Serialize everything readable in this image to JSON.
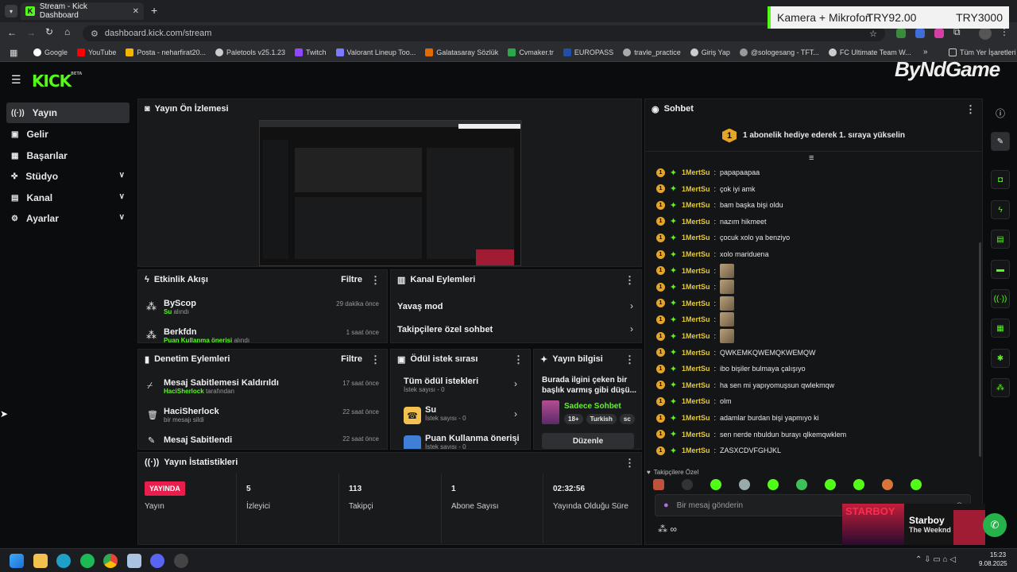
{
  "browser": {
    "tab_title": "Stream - Kick Dashboard",
    "url": "dashboard.kick.com/stream",
    "bookmarks": [
      "Google",
      "YouTube",
      "Posta - neharfirat20...",
      "Paletools v25.1.23",
      "Twitch",
      "Valorant Lineup Too...",
      "Galatasaray Sözlük",
      "Cvmaker.tr",
      "EUROPASS",
      "travle_practice",
      "Giriş Yap",
      "@sologesang - TFT...",
      "FC Ultimate Team W..."
    ],
    "bookmarks_more": "»",
    "all_bookmarks": "Tüm Yer İşaretleri"
  },
  "overlay": {
    "camera_text": "Kamera + Mikrofon",
    "price1": "TRY92.00",
    "price2": "TRY3000",
    "brand": "ByNdGame",
    "song_title": "Starboy",
    "song_artist": "The Weeknd",
    "album_text": "STARBOY"
  },
  "app": {
    "logo": "KICK",
    "logo_beta": "BETA"
  },
  "sidebar": {
    "items": [
      {
        "label": "Yayın",
        "icon": "broadcast-icon"
      },
      {
        "label": "Gelir",
        "icon": "income-icon"
      },
      {
        "label": "Başarılar",
        "icon": "achievements-icon"
      },
      {
        "label": "Stüdyo",
        "icon": "studio-icon"
      },
      {
        "label": "Kanal",
        "icon": "channel-icon"
      },
      {
        "label": "Ayarlar",
        "icon": "settings-icon"
      }
    ]
  },
  "preview": {
    "title": "Yayın Ön İzlemesi"
  },
  "activity": {
    "title": "Etkinlik Akışı",
    "filter": "Filtre",
    "items": [
      {
        "name": "ByScop",
        "action_highlight": "Su",
        "action": "alındı",
        "time": "29 dakika önce"
      },
      {
        "name": "Berkfdn",
        "action_highlight": "Puan Kullanma önerisi",
        "action": "alındı",
        "time": "1 saat önce"
      }
    ]
  },
  "channel_actions": {
    "title": "Kanal Eylemleri",
    "items": [
      "Yavaş mod",
      "Takipçilere özel sohbet"
    ]
  },
  "moderation": {
    "title": "Denetim Eylemleri",
    "filter": "Filtre",
    "items": [
      {
        "title": "Mesaj Sabitlemesi Kaldırıldı",
        "user": "HaciSherlock",
        "sub": "tarafından",
        "time": "17 saat önce"
      },
      {
        "title": "HaciSherlock",
        "user": "",
        "sub": "bir mesajı sildi",
        "time": "22 saat önce"
      },
      {
        "title": "Mesaj Sabitlendi",
        "user": "",
        "sub": "",
        "time": "22 saat önce"
      }
    ]
  },
  "rewards": {
    "title": "Ödül istek sırası",
    "items": [
      {
        "title": "Tüm ödül istekleri",
        "sub": "İstek sayısı - 0"
      },
      {
        "title": "Su",
        "sub": "İstek sayısı - 0"
      },
      {
        "title": "Puan Kullanma önerisi",
        "sub": "İstek sayısı - 0"
      }
    ]
  },
  "stream_info": {
    "title": "Yayın bilgisi",
    "stream_title": "Burada ilgini çeken bir başlık varmış gibi düşü...",
    "category": "Sadece Sohbet",
    "tags": [
      "18+",
      "Turkish",
      "sc"
    ],
    "edit": "Düzenle"
  },
  "stats": {
    "title": "Yayın İstatistikleri",
    "live_badge": "YAYINDA",
    "cols": [
      {
        "value": "",
        "label": "Yayın"
      },
      {
        "value": "5",
        "label": "İzleyici"
      },
      {
        "value": "113",
        "label": "Takipçi"
      },
      {
        "value": "1",
        "label": "Abone Sayısı"
      },
      {
        "value": "02:32:56",
        "label": "Yayında Olduğu Süre"
      }
    ]
  },
  "chat": {
    "title": "Sohbet",
    "gift_banner": "1 abonelik hediye ederek 1. sıraya yükselin",
    "gift_rank": "1",
    "messages": [
      {
        "user": "1MertSu",
        "text": "papapaapaa"
      },
      {
        "user": "1MertSu",
        "text": "çok iyi amk"
      },
      {
        "user": "1MertSu",
        "text": "bam başka bişi oldu"
      },
      {
        "user": "1MertSu",
        "text": "nazım hikmeet"
      },
      {
        "user": "1MertSu",
        "text": "çocuk xolo ya benziyo"
      },
      {
        "user": "1MertSu",
        "text": "xolo mariduena"
      },
      {
        "user": "1MertSu",
        "text": ""
      },
      {
        "user": "1MertSu",
        "text": ""
      },
      {
        "user": "1MertSu",
        "text": ""
      },
      {
        "user": "1MertSu",
        "text": ""
      },
      {
        "user": "1MertSu",
        "text": ""
      },
      {
        "user": "1MertSu",
        "text": "QWKEMKQWEMQKWEMQW"
      },
      {
        "user": "1MertSu",
        "text": "ibo bişiler bulmaya çalışıyo"
      },
      {
        "user": "1MertSu",
        "text": "ha sen mi yapıyomuşsun qwlekmqw"
      },
      {
        "user": "1MertSu",
        "text": "olm"
      },
      {
        "user": "1MertSu",
        "text": "adamlar burdan bişi yapmıyo ki"
      },
      {
        "user": "1MertSu",
        "text": "sen nerde nbuldun burayı qlkemqwklem"
      },
      {
        "user": "1MertSu",
        "text": "ZASXCDVFGHJKL"
      }
    ],
    "followers_only": "Takipçilere Özel",
    "input_placeholder": "Bir mesaj gönderin"
  },
  "taskbar": {
    "time": "15:23",
    "date": "9.08.2025"
  },
  "colors": {
    "accent": "#53fc18",
    "live": "#e91e4c",
    "username": "#e2c93a",
    "badge": "#e2a52a"
  }
}
